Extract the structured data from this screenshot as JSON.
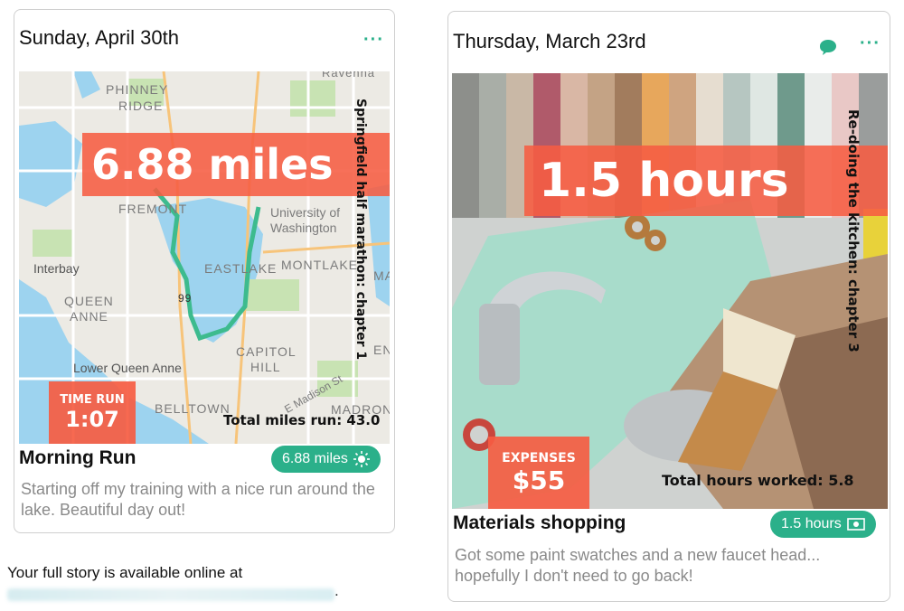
{
  "cards": [
    {
      "date": "Sunday, April 30th",
      "menu": "···",
      "banner": "6.88 miles",
      "side_caption": "Springfield half marathon: chapter 1",
      "stat_label": "TIME RUN",
      "stat_value": "1:07",
      "total": "Total miles run: 43.0",
      "title": "Morning Run",
      "pill": "6.88 miles",
      "pill_icon": "sun-icon",
      "description": "Starting off my training with a nice run around the lake. Beautiful day out!",
      "map_labels": [
        "Ravenna",
        "PHINNEY",
        "RIDGE",
        "FREMONT",
        "University of",
        "Washington",
        "Interbay",
        "EASTLAKE",
        "MONTLAKE",
        "QUEEN",
        "ANNE",
        "CAPITOL",
        "HILL",
        "Lower Queen Anne",
        "E Madison St",
        "BELLTOWN",
        "MADRONA",
        "ENI",
        "MA",
        "99"
      ]
    },
    {
      "date": "Thursday, March 23rd",
      "menu": "···",
      "banner": "1.5 hours",
      "side_caption": "Re-doing the kitchen: chapter 3",
      "stat_label": "EXPENSES",
      "stat_value": "$55",
      "total": "Total hours worked: 5.8",
      "title": "Materials shopping",
      "pill": "1.5 hours",
      "pill_icon": "cash-icon",
      "description": "Got some paint swatches and a new faucet head... hopefully I don't need to go back!",
      "comment_icon": "comment-icon"
    }
  ],
  "footer": {
    "text": "Your full story is available online at",
    "suffix": "."
  },
  "colors": {
    "accent": "#2bb08a",
    "banner": "#f65c42"
  }
}
